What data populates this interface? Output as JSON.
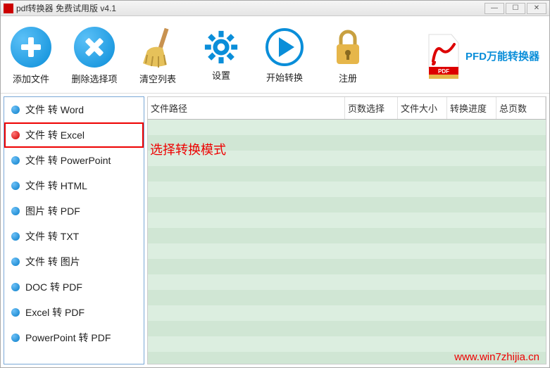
{
  "title": "pdf转换器 免费试用版 v4.1",
  "toolbar": {
    "add": "添加文件",
    "remove": "删除选择项",
    "clear": "清空列表",
    "settings": "设置",
    "start": "开始转换",
    "register": "注册"
  },
  "brand": "PFD万能转换器",
  "sidebar": {
    "items": [
      {
        "label": "文件 转 Word",
        "selected": false
      },
      {
        "label": "文件 转 Excel",
        "selected": true
      },
      {
        "label": "文件 转 PowerPoint",
        "selected": false
      },
      {
        "label": "文件 转 HTML",
        "selected": false
      },
      {
        "label": "图片 转 PDF",
        "selected": false
      },
      {
        "label": "文件 转 TXT",
        "selected": false
      },
      {
        "label": "文件 转 图片",
        "selected": false
      },
      {
        "label": "DOC 转 PDF",
        "selected": false
      },
      {
        "label": "Excel 转 PDF",
        "selected": false
      },
      {
        "label": "PowerPoint 转 PDF",
        "selected": false
      }
    ]
  },
  "columns": {
    "path": "文件路径",
    "pages": "页数选择",
    "size": "文件大小",
    "progress": "转换进度",
    "total": "总页数"
  },
  "annotation": "选择转换模式",
  "watermark": "www.win7zhijia.cn"
}
